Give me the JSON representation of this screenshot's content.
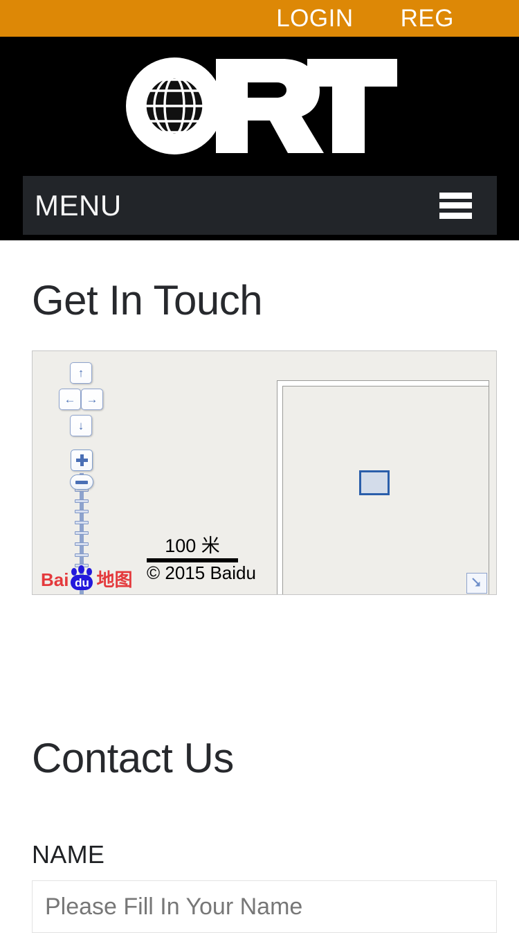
{
  "topbar": {
    "background_color": "#dd8806",
    "login_label": "LOGIN",
    "reg_label": "REG"
  },
  "masthead": {
    "background_color": "#000000",
    "logo_text": "ORT",
    "logo_icon": "globe-icon",
    "menu": {
      "label": "MENU",
      "background_color": "#222529",
      "icon": "hamburger-icon"
    }
  },
  "page": {
    "get_in_touch_heading": "Get In Touch",
    "contact_us_heading": "Contact Us",
    "heading_color": "#27292d"
  },
  "map": {
    "provider": "Baidu",
    "background_color": "#efeeea",
    "scale_distance": "100 米",
    "copyright": "© 2015 Baidu",
    "logo_part_1": "Bai",
    "logo_part_2": "du",
    "logo_part_3": "地图",
    "controls": {
      "pan_up": "↑",
      "pan_left": "←",
      "pan_right": "→",
      "pan_down": "↓",
      "zoom_in": "+",
      "zoom_out": "−",
      "zoom_tick_count": 14
    },
    "overview": {
      "collapse_icon": "arrow-down-right-icon"
    }
  },
  "contact_form": {
    "name_label": "NAME",
    "name_placeholder": "Please Fill In Your Name",
    "name_value": ""
  }
}
